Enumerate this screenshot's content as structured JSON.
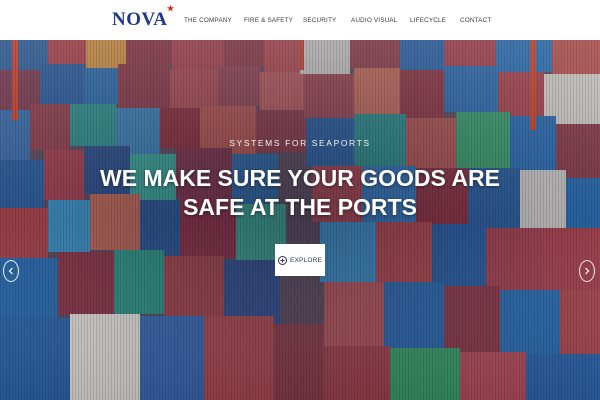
{
  "header": {
    "logo_text": "NOVA",
    "logo_star": "★",
    "nav_items": [
      {
        "label": "THE COMPANY"
      },
      {
        "label": "FIRE & SAFETY"
      },
      {
        "label": "SECURITY"
      },
      {
        "label": "AUDIO VISUAL"
      },
      {
        "label": "LIFECYCLE"
      },
      {
        "label": "CONTACT"
      }
    ]
  },
  "hero": {
    "kicker": "SYSTEMS FOR SEAPORTS",
    "title_line1": "WE MAKE SURE YOUR GOODS ARE",
    "title_line2": "SAFE AT THE PORTS",
    "button_label": "EXPLORE",
    "button_icon": "plus-circle-icon",
    "prev_icon": "chevron-left-icon",
    "next_icon": "chevron-right-icon"
  },
  "colors": {
    "logo": "#1d3a8a",
    "logo_accent": "#d62828",
    "button_text": "#2a3550"
  }
}
